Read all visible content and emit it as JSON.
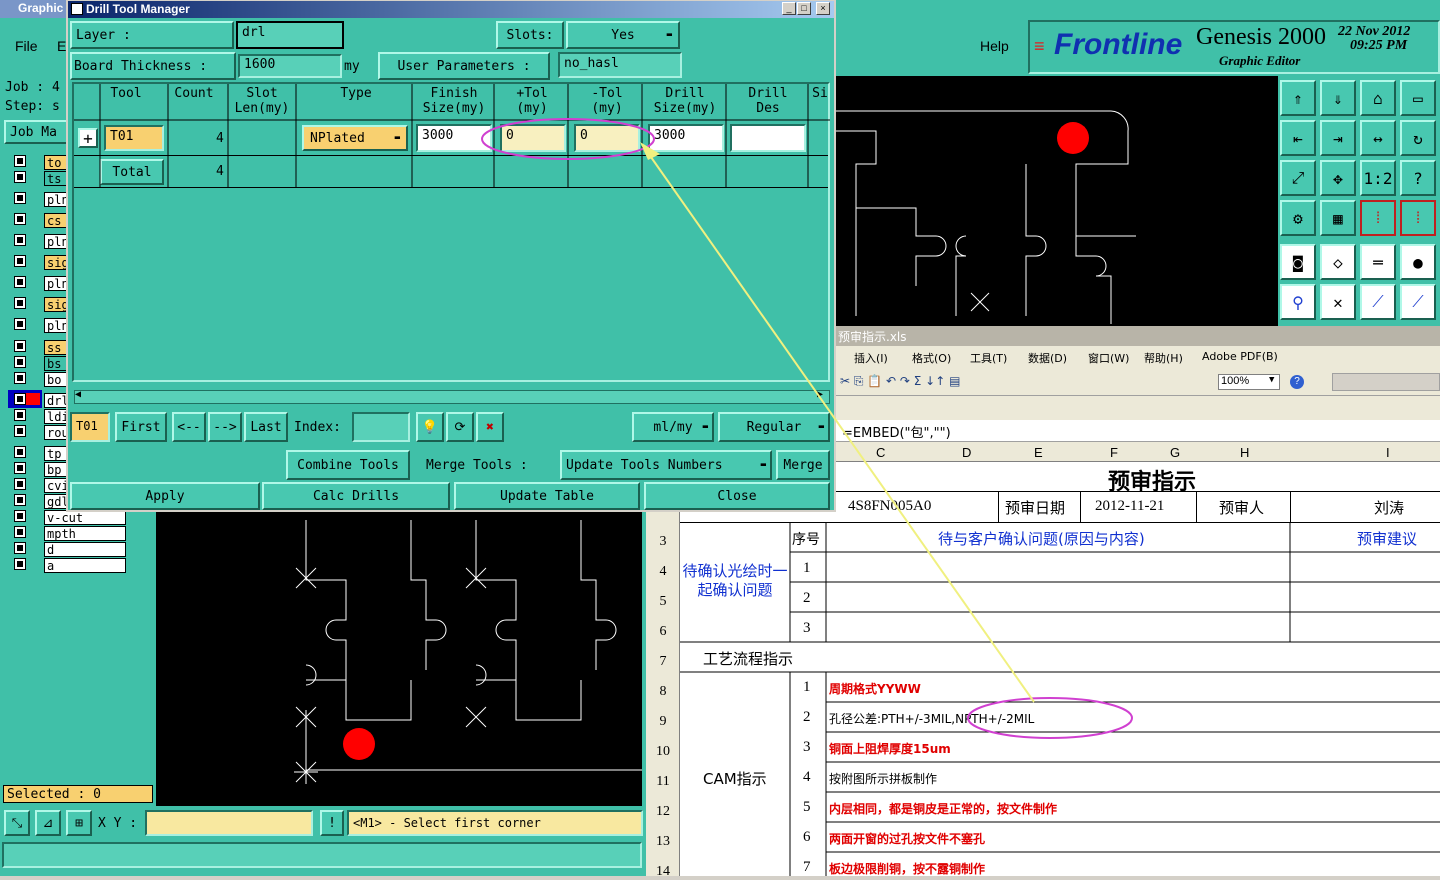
{
  "graphic_window": {
    "title": "Graphic",
    "menu": {
      "file": "File",
      "edit": "E",
      "help": "Help"
    },
    "job_label": "Job  :  4",
    "step_label": "Step:  s",
    "job_manager_btn": "Job Ma",
    "layers": [
      "to",
      "ts",
      "pln",
      "cs",
      "pln",
      "sig",
      "pln",
      "sig",
      "pln",
      "ss",
      "bs",
      "bo",
      "drl",
      "ldi",
      "rou",
      "tp",
      "bp",
      "cvi",
      "gdl",
      "v-cut",
      "mpth",
      "d",
      "a"
    ],
    "selected": "Selected : 0",
    "xy_label": "X Y :",
    "xy_value": "",
    "status_text": "<M1> - Select first corner"
  },
  "brand": {
    "logo": "Frontline",
    "product": "Genesis 2000",
    "subtitle": "Graphic Editor",
    "date": "22  Nov  2012",
    "time": "09:25  PM"
  },
  "icon_grid": [
    "open-step-icon",
    "save-icon",
    "home-icon",
    "window-icon",
    "align-left-icon",
    "align-right-icon",
    "mirror-icon",
    "rotate-icon",
    "fit-icon",
    "center-icon",
    "scale-icon",
    "help-icon",
    "measure-icon",
    "grid-icon",
    "snap-icon",
    "snap2-icon",
    "pad-icon",
    "rectangle-icon",
    "ruler-icon",
    "circle-icon",
    "net-icon",
    "cross-icon",
    "line-icon",
    "arc-icon"
  ],
  "drill_manager": {
    "title": "Drill Tool Manager",
    "layer_label": "Layer          :",
    "layer_value": "drl",
    "slots_label": "Slots:",
    "slots_value": "Yes",
    "board_thickness_label": "Board Thickness :",
    "board_thickness_value": "1600",
    "board_thickness_unit": "my",
    "user_params_label": "User Parameters :",
    "user_params_value": "no_hasl",
    "columns": [
      "Tool",
      "Count",
      "Slot\nLen(my)",
      "Type",
      "Finish\nSize(my)",
      "+Tol\n(my)",
      "-Tol\n(my)",
      "Drill\nSize(my)",
      "Drill\nDes",
      "Si"
    ],
    "row": {
      "tool": "T01",
      "count": "4",
      "type": "NPlated",
      "finish": "3000",
      "ptol": "0",
      "ntol": "0",
      "drill_size": "3000",
      "drill_des": ""
    },
    "total": {
      "label": "Total",
      "count": "4"
    },
    "nav": {
      "current": "T01",
      "first": "First",
      "prev": "<--",
      "next": "-->",
      "last": "Last",
      "index_label": "Index:",
      "index_value": "",
      "units": "ml/my",
      "mode": "Regular"
    },
    "actions": {
      "combine": "Combine Tools",
      "merge_label": "Merge Tools  :",
      "update_numbers": "Update Tools Numbers",
      "merge": "Merge"
    },
    "bottom": {
      "apply": "Apply",
      "calc": "Calc Drills",
      "update": "Update Table",
      "close": "Close"
    }
  },
  "excel": {
    "title": "预审指示.xls",
    "menu": [
      "插入(I)",
      "格式(O)",
      "工具(T)",
      "数据(D)",
      "窗口(W)",
      "帮助(H)",
      "Adobe PDF(B)"
    ],
    "zoom": "100%",
    "formula": "=EMBED(\"包\",\"\")",
    "columns": [
      "C",
      "D",
      "E",
      "F",
      "G",
      "H",
      "I"
    ],
    "heading": "预审指示",
    "row2": {
      "part": "4S8FN005A0",
      "date_label": "预审日期",
      "date": "2012-11-21",
      "person_label": "预审人",
      "person": "刘涛"
    },
    "row3": {
      "seq": "序号",
      "issue": "待与客户确认问题(原因与内容)",
      "suggest": "预审建议",
      "side": "待确认光绘时一起确认问题"
    },
    "confirm_nums": [
      "1",
      "2",
      "3"
    ],
    "row7": "工艺流程指示",
    "cam_label": "CAM指示",
    "cam_items": [
      {
        "n": "1",
        "text": "周期格式YYWW",
        "red": true
      },
      {
        "n": "2",
        "text": "孔径公差:PTH+/-3MIL,NPTH+/-2MIL",
        "red": false
      },
      {
        "n": "3",
        "text": "铜面上阻焊厚度15um",
        "red": true
      },
      {
        "n": "4",
        "text": "按附图所示拼板制作",
        "red": false
      },
      {
        "n": "5",
        "text": "内层相同，都是铜皮是正常的，按文件制作",
        "red": true
      },
      {
        "n": "6",
        "text": "两面开窗的过孔按文件不塞孔",
        "red": true
      },
      {
        "n": "7",
        "text": "板边极限削铜，按不露铜制作",
        "red": true
      }
    ],
    "row_numbers": [
      "3",
      "4",
      "5",
      "6",
      "7",
      "8",
      "9",
      "10",
      "11",
      "12",
      "13",
      "14"
    ]
  }
}
